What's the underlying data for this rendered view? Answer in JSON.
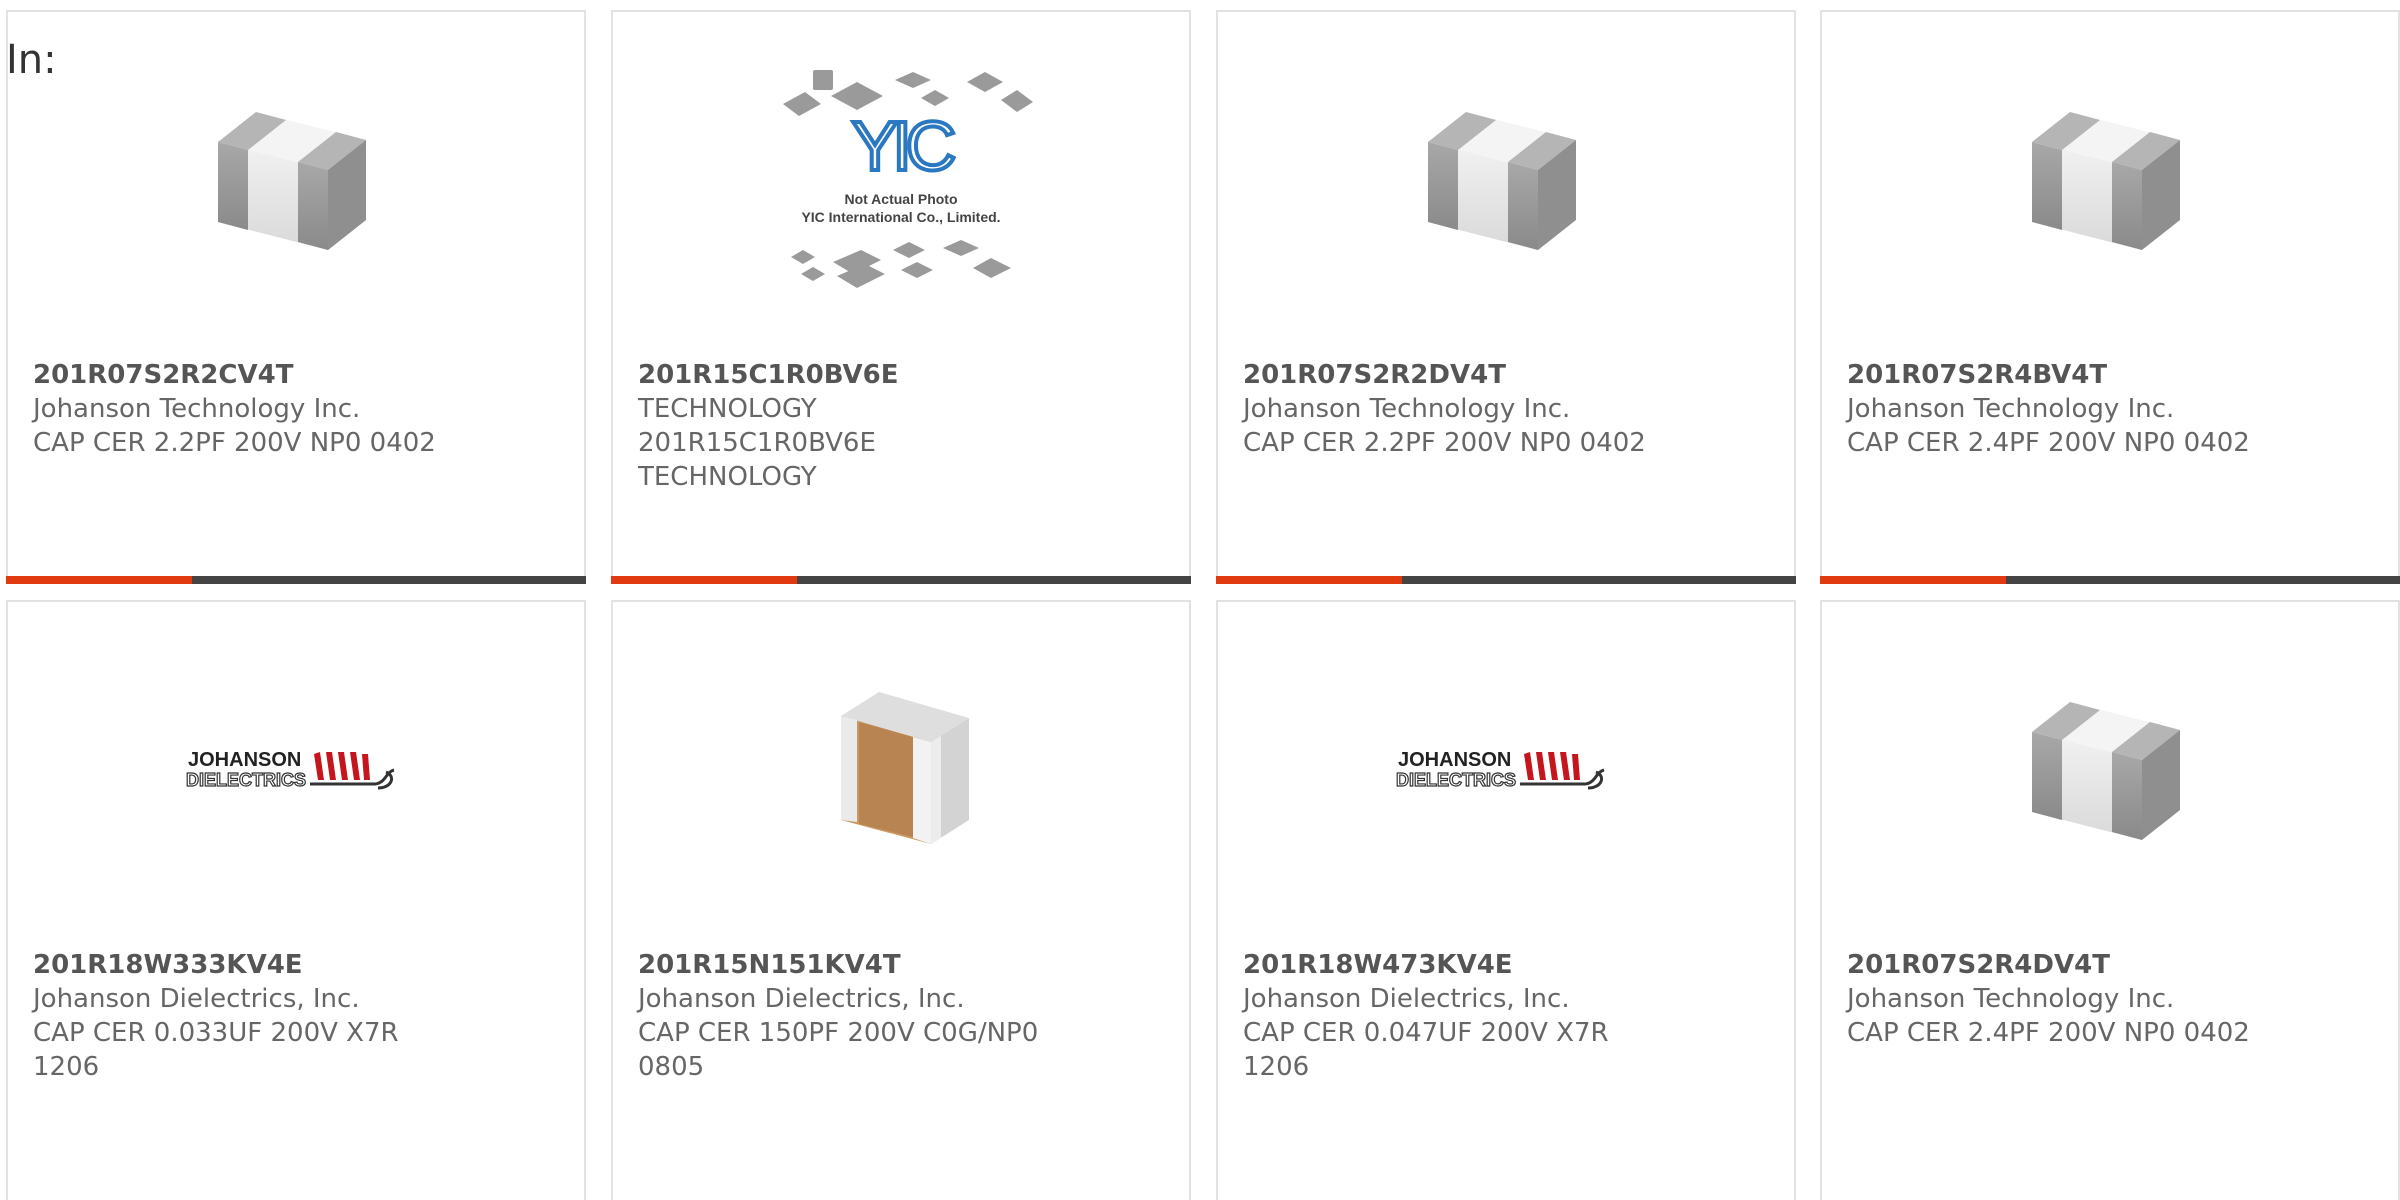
{
  "filter": {
    "label": "In:"
  },
  "accent_color": "#e23a10",
  "bar_color": "#444444",
  "yic_logo": {
    "brand": "YIC",
    "line1": "Not Actual Photo",
    "line2": "YIC International Co., Limited."
  },
  "johanson_logo": {
    "line1": "JOHANSON",
    "line2": "DIELECTRICS"
  },
  "products": [
    {
      "part_number": "201R07S2R2CV4T",
      "manufacturer": "Johanson Technology Inc.",
      "description": "CAP CER 2.2PF 200V NP0 0402",
      "image": "chip-capacitor-0402-photo",
      "progress": 0.32
    },
    {
      "part_number": "201R15C1R0BV6E",
      "manufacturer": "TECHNOLOGY",
      "description": "201R15C1R0BV6E TECHNOLOGY",
      "image": "yic-not-actual-photo",
      "progress": 0.32
    },
    {
      "part_number": "201R07S2R2DV4T",
      "manufacturer": "Johanson Technology Inc.",
      "description": "CAP CER 2.2PF 200V NP0 0402",
      "image": "chip-capacitor-0402-photo",
      "progress": 0.32
    },
    {
      "part_number": "201R07S2R4BV4T",
      "manufacturer": "Johanson Technology Inc.",
      "description": "CAP CER 2.4PF 200V NP0 0402",
      "image": "chip-capacitor-0402-photo",
      "progress": 0.32
    },
    {
      "part_number": "201R18W333KV4E",
      "manufacturer": "Johanson Dielectrics, Inc.",
      "description": "CAP CER 0.033UF 200V X7R 1206",
      "image": "johanson-dielectrics-logo"
    },
    {
      "part_number": "201R15N151KV4T",
      "manufacturer": "Johanson Dielectrics, Inc.",
      "description": "CAP CER 150PF 200V C0G/NP0 0805",
      "image": "chip-capacitor-0805-photo"
    },
    {
      "part_number": "201R18W473KV4E",
      "manufacturer": "Johanson Dielectrics, Inc.",
      "description": "CAP CER 0.047UF 200V X7R 1206",
      "image": "johanson-dielectrics-logo"
    },
    {
      "part_number": "201R07S2R4DV4T",
      "manufacturer": "Johanson Technology Inc.",
      "description": "CAP CER 2.4PF 200V NP0 0402",
      "image": "chip-capacitor-0402-photo"
    }
  ]
}
